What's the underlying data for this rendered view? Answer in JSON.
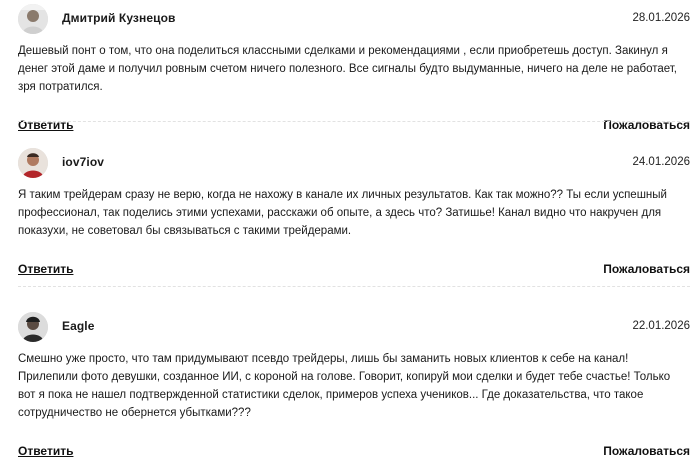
{
  "comments": [
    {
      "author": "Дмитрий Кузнецов",
      "date": "28.01.2026",
      "text": "Дешевый понт о том, что она поделиться классными сделками и рекомендациями , если приобретешь доступ. Закинул я денег этой даме и получил ровным счетом ничего полезного. Все сигналы будто выдуманные, ничего на деле не работает, зря потратился.",
      "reply_label": "Ответить",
      "report_label": "Пожаловаться"
    },
    {
      "author": "iov7iov",
      "date": "24.01.2026",
      "text": "Я таким трейдерам сразу не верю, когда не нахожу в канале их личных результатов. Как так можно?? Ты если успешный профессионал, так поделись этими успехами, расскажи об опыте, а здесь что? Затишье! Канал видно что накручен для показухи, не советовал бы связываться с такими трейдерами.",
      "reply_label": "Ответить",
      "report_label": "Пожаловаться"
    },
    {
      "author": "Eagle",
      "date": "22.01.2026",
      "text": "Смешно уже просто, что там придумывают псевдо трейдеры, лишь бы заманить новых клиентов к себе на канал! Прилепили фото девушки, созданное ИИ, с короной на голове. Говорит, копируй мои сделки и будет тебе счастье! Только вот я пока не нашел подтвержденной статистики сделок, примеров успеха учеников... Где доказательства, что такое сотрудничество не обернется убытками???",
      "reply_label": "Ответить",
      "report_label": "Пожаловаться"
    }
  ]
}
